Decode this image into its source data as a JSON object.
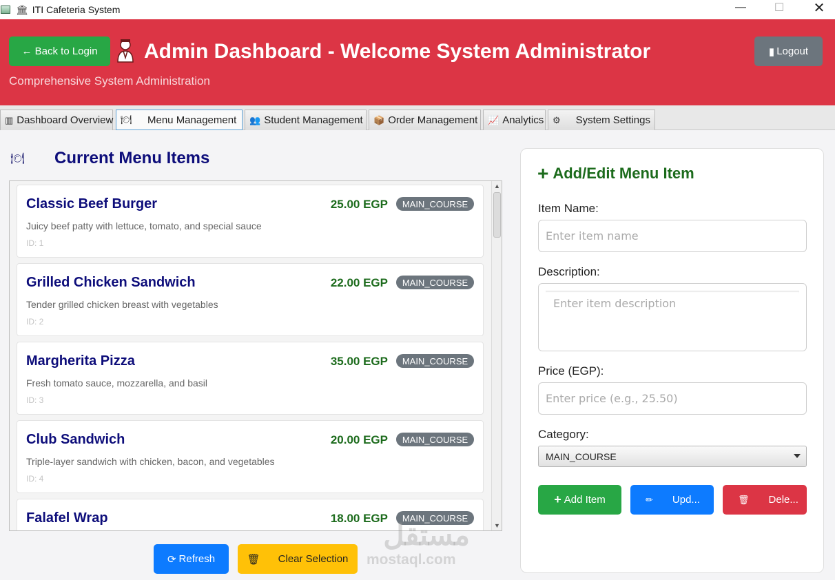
{
  "window": {
    "title": "ITI Cafeteria System",
    "minimize": "—",
    "maximize": "☐",
    "close": "✕"
  },
  "header": {
    "back_label": "← Back to Login",
    "title": "Admin Dashboard - Welcome System Administrator",
    "subtitle": "Comprehensive System Administration",
    "logout_label": "Logout",
    "colors": {
      "header_bg": "#dc3545",
      "back_bg": "#28a745",
      "logout_bg": "#6c757d"
    }
  },
  "tabs": [
    {
      "icon": "▥",
      "label": "Dashboard Overview"
    },
    {
      "icon": "🍽",
      "label": "Menu Management",
      "active": true
    },
    {
      "icon": "👥",
      "label": "Student Management"
    },
    {
      "icon": "📦",
      "label": "Order Management"
    },
    {
      "icon": "📈",
      "label": "Analytics"
    },
    {
      "icon": "⚙",
      "label": "System Settings"
    }
  ],
  "menu_list": {
    "title": "Current Menu Items",
    "items": [
      {
        "name": "Classic Beef Burger",
        "price": "25.00 EGP",
        "category": "MAIN_COURSE",
        "description": "Juicy beef patty with lettuce, tomato, and special sauce",
        "id": "ID: 1"
      },
      {
        "name": "Grilled Chicken Sandwich",
        "price": "22.00 EGP",
        "category": "MAIN_COURSE",
        "description": "Tender grilled chicken breast with vegetables",
        "id": "ID: 2"
      },
      {
        "name": "Margherita Pizza",
        "price": "35.00 EGP",
        "category": "MAIN_COURSE",
        "description": "Fresh tomato sauce, mozzarella, and basil",
        "id": "ID: 3"
      },
      {
        "name": "Club Sandwich",
        "price": "20.00 EGP",
        "category": "MAIN_COURSE",
        "description": "Triple-layer sandwich with chicken, bacon, and vegetables",
        "id": "ID: 4"
      },
      {
        "name": "Falafel Wrap",
        "price": "18.00 EGP",
        "category": "MAIN_COURSE",
        "description": "",
        "id": ""
      }
    ],
    "refresh_label": "Refresh",
    "clear_label": "Clear Selection"
  },
  "form": {
    "title": "Add/Edit Menu Item",
    "name_label": "Item Name:",
    "name_placeholder": "Enter item name",
    "desc_label": "Description:",
    "desc_placeholder": "Enter item description",
    "price_label": "Price (EGP):",
    "price_placeholder": "Enter price (e.g., 25.50)",
    "category_label": "Category:",
    "category_value": "MAIN_COURSE",
    "add_label": "Add Item",
    "update_label": "Upd...",
    "delete_label": "Dele..."
  },
  "watermark": {
    "arabic": "مستقل",
    "latin": "mostaql.com"
  }
}
